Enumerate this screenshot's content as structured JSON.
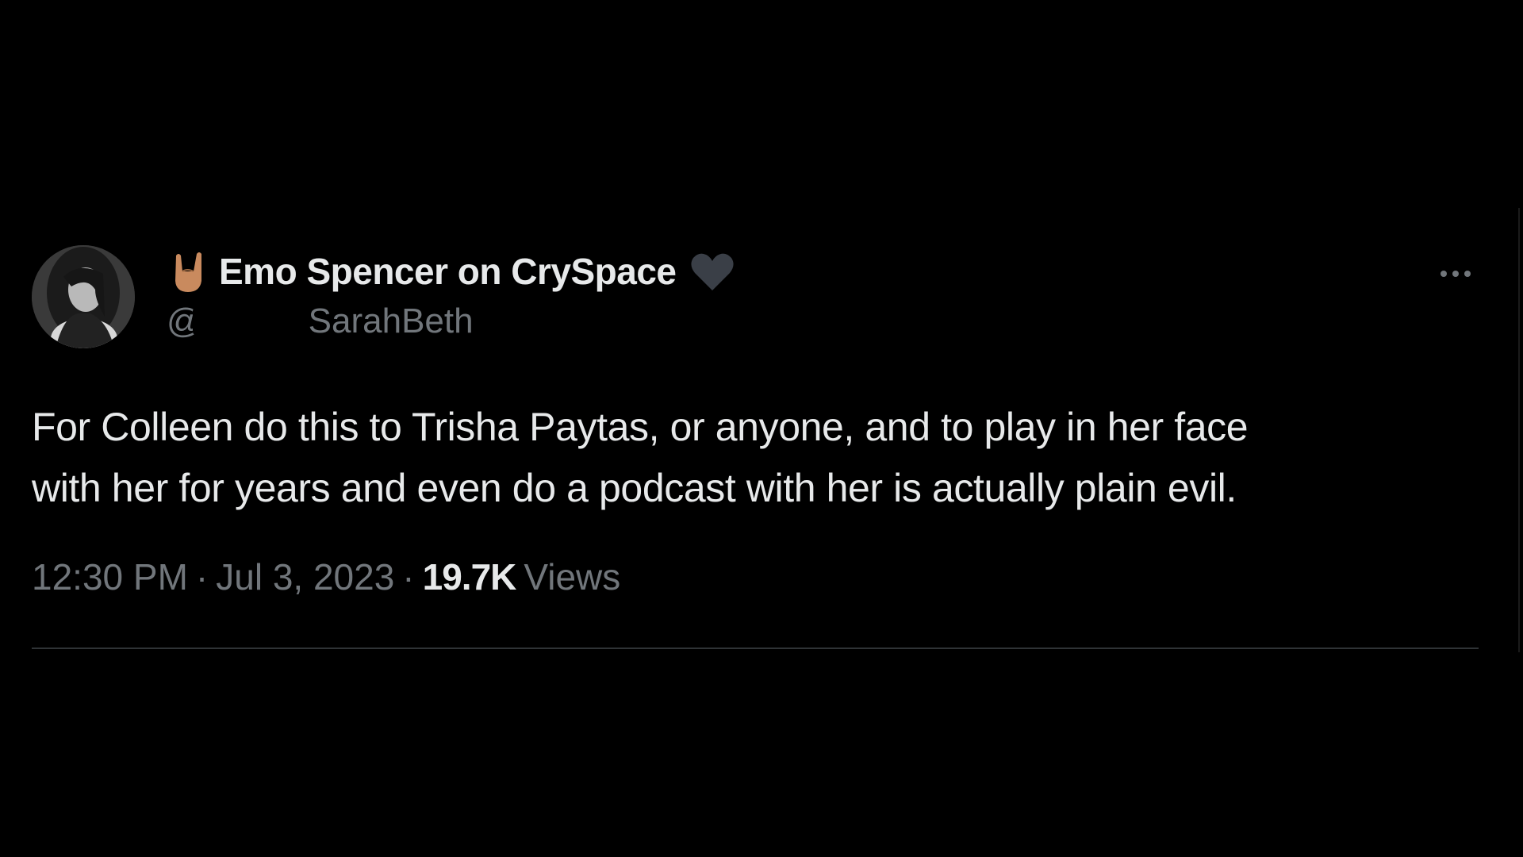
{
  "tweet": {
    "author": {
      "display_name": "Emo Spencer on CrySpace",
      "handle_prefix": "@",
      "handle_visible": "SarahBeth",
      "name_prefix_icon": "sign-of-horns-icon",
      "name_suffix_icon": "black-heart-icon",
      "avatar_icon": "profile-photo-avatar"
    },
    "text_line_1": "For Colleen do this to Trisha Paytas, or anyone, and to play in her face",
    "text_line_2": "with her for years and even do a podcast with her is actually plain evil.",
    "time": "12:30 PM",
    "date": "Jul 3, 2023",
    "separator": "·",
    "views_count": "19.7K",
    "views_label": "Views",
    "more_icon": "more-horizontal-icon"
  },
  "colors": {
    "background": "#000000",
    "primary_text": "#e7e9ea",
    "secondary_text": "#71767b",
    "divider": "#2f3336",
    "hand_emoji": "#c98a5e",
    "heart": "#3a3f47"
  }
}
